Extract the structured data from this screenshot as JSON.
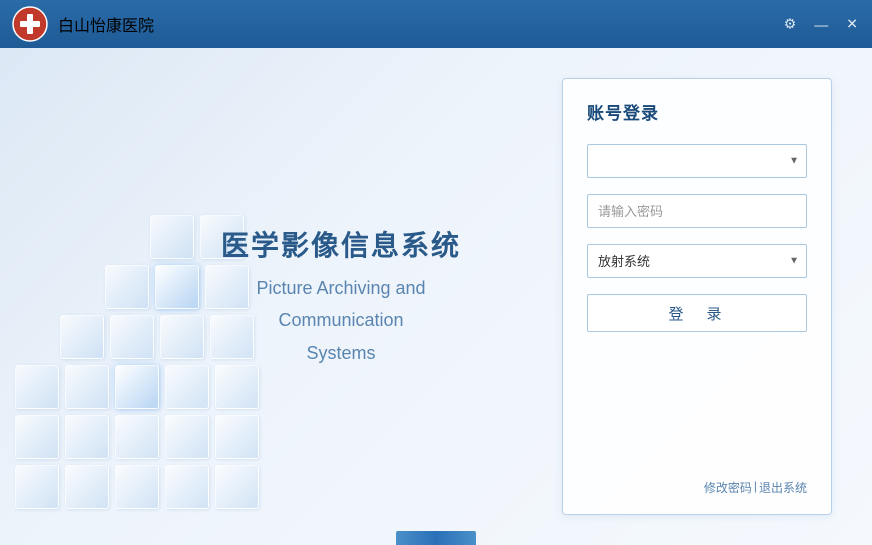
{
  "titleBar": {
    "appName": "白山怡康医院",
    "gearIcon": "⚙",
    "minIcon": "—",
    "closeIcon": "✕"
  },
  "main": {
    "systemTitleCn": "医学影像信息系统",
    "systemTitleEn1": "Picture Archiving and",
    "systemTitleEn2": "Communication",
    "systemTitleEn3": "Systems"
  },
  "loginPanel": {
    "title": "账号登录",
    "usernamePlaceholder": "",
    "passwordPlaceholder": "请输入密码",
    "systemDefault": "放射系统",
    "loginButton": "登　录",
    "changePassword": "修改密码",
    "separator": "|",
    "exitSystem": "退出系统"
  }
}
